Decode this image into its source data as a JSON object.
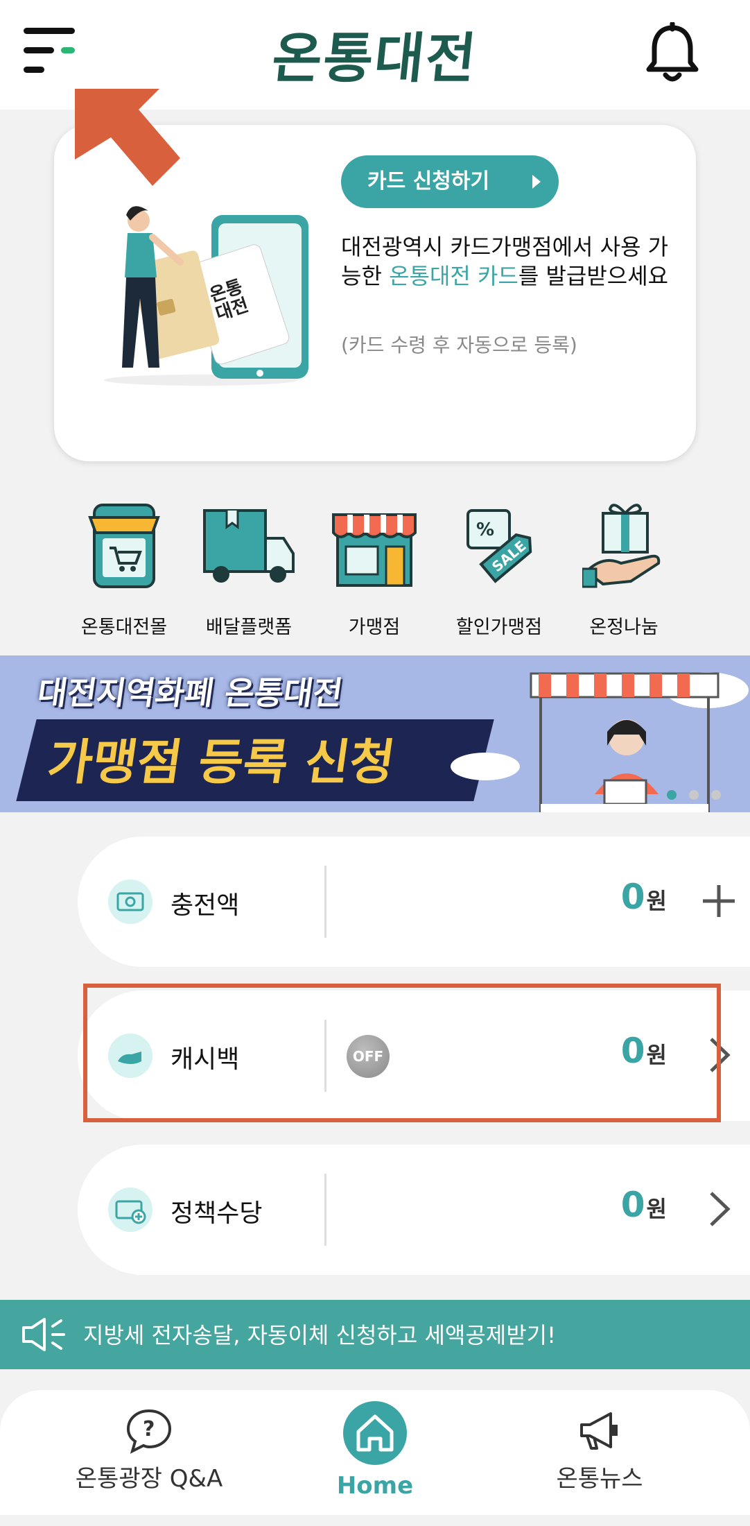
{
  "header": {
    "logo_text": "온통대전"
  },
  "promo": {
    "apply_button": "카드 신청하기",
    "text_part1": "대전광역시 카드가맹점에서 사용 가능한 ",
    "text_highlight": "온통대전 카드",
    "text_part2": "를 발급받으세요",
    "note": "(카드 수령 후 자동으로 등록)"
  },
  "categories": [
    {
      "label": "온통대전몰",
      "icon": "shopping-cart-phone-icon"
    },
    {
      "label": "배달플랫폼",
      "icon": "delivery-truck-icon"
    },
    {
      "label": "가맹점",
      "icon": "store-icon"
    },
    {
      "label": "할인가맹점",
      "icon": "sale-tag-icon"
    },
    {
      "label": "온정나눔",
      "icon": "gift-hand-icon"
    }
  ],
  "banner": {
    "line1": "대전지역화폐 온통대전",
    "line2": "가맹점 등록 신청"
  },
  "balances": [
    {
      "name": "충전액",
      "amount": "0",
      "unit": "원",
      "action": "plus-icon"
    },
    {
      "name": "캐시백",
      "amount": "0",
      "unit": "원",
      "toggle": "OFF",
      "action": "chevron-right-icon"
    },
    {
      "name": "정책수당",
      "amount": "0",
      "unit": "원",
      "action": "chevron-right-icon"
    }
  ],
  "notice": {
    "text": "지방세 전자송달, 자동이체 신청하고 세액공제받기!"
  },
  "nav": [
    {
      "label": "온통광장 Q&A"
    },
    {
      "label": "Home"
    },
    {
      "label": "온통뉴스"
    }
  ],
  "colors": {
    "accent": "#3aa5a4",
    "brand_dark": "#1e5b4f",
    "highlight_box": "#d9603d",
    "banner_bg": "#a7b7e6",
    "banner_yellow": "#f7c948"
  }
}
